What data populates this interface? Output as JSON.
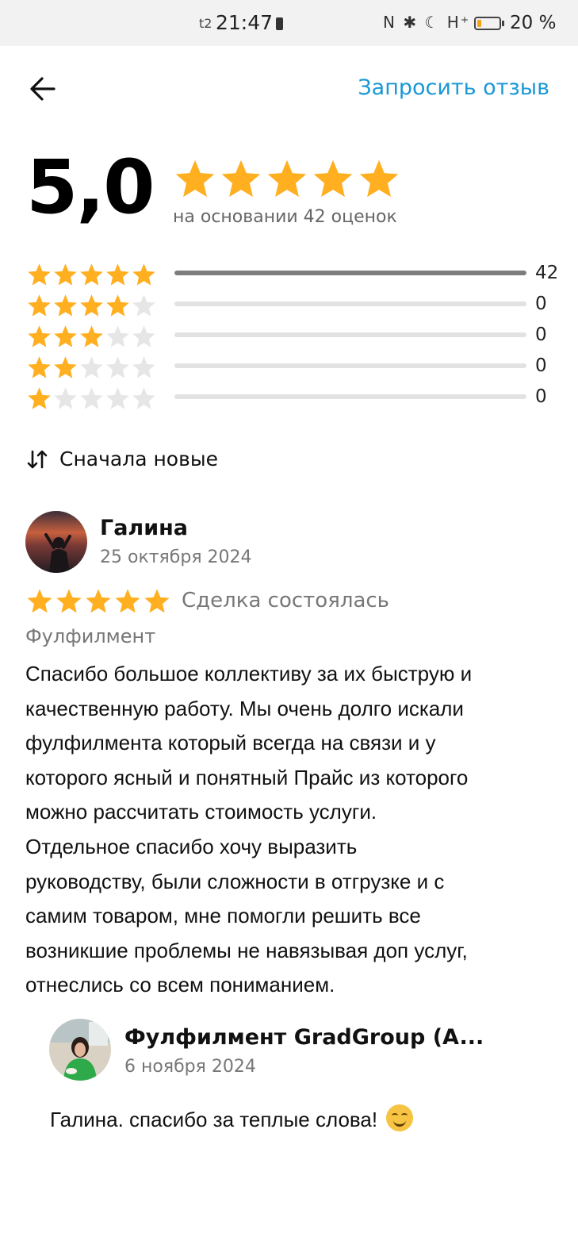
{
  "status_bar": {
    "carrier": "t2",
    "time": "21:47",
    "icons": "N ✱ ☾ H⁺",
    "battery_percent": "20 %",
    "battery_level": 0.2,
    "battery_color": "#f3a316"
  },
  "header": {
    "back_icon": "arrow-left-icon",
    "request_review_label": "Запросить отзыв"
  },
  "summary": {
    "score": "5,0",
    "stars": 5,
    "based_on": "на основании 42 оценок"
  },
  "breakdown": [
    {
      "stars": 5,
      "count": "42",
      "fraction": 1.0
    },
    {
      "stars": 4,
      "count": "0",
      "fraction": 0
    },
    {
      "stars": 3,
      "count": "0",
      "fraction": 0
    },
    {
      "stars": 2,
      "count": "0",
      "fraction": 0
    },
    {
      "stars": 1,
      "count": "0",
      "fraction": 0
    }
  ],
  "sort": {
    "icon": "sort-arrows-icon",
    "label": "Сначала новые"
  },
  "review": {
    "author": "Галина",
    "date": "25 октября 2024",
    "stars": 5,
    "deal_status": "Сделка состоялась",
    "category": "Фулфилмент",
    "text": "Спасибо большое коллективу за их быструю и\nкачественную работу. Мы очень долго искали\nфулфилмента который всегда на связи и у\nкоторого ясный и понятный Прайс из которого\nможно рассчитать стоимость услуги.\nОтдельное спасибо хочу выразить\nруководству, были сложности в отгрузке и с\nсамим товаром, мне помогли  решить все\nвозникшие проблемы не навязывая доп услуг,\nотнеслись со всем пониманием.",
    "reply": {
      "author": "Фулфилмент GradGroup (A...",
      "date": "6 ноября 2024",
      "text": "Галина. спасибо за теплые слова!",
      "emoji": "smiling-face-emoji"
    }
  },
  "colors": {
    "star_filled": "#ffaf1f",
    "star_empty": "#e6e6e6",
    "accent_link": "#1a98d5",
    "bar_fill": "#7d7d7d",
    "bar_track": "#e2e2e2"
  }
}
